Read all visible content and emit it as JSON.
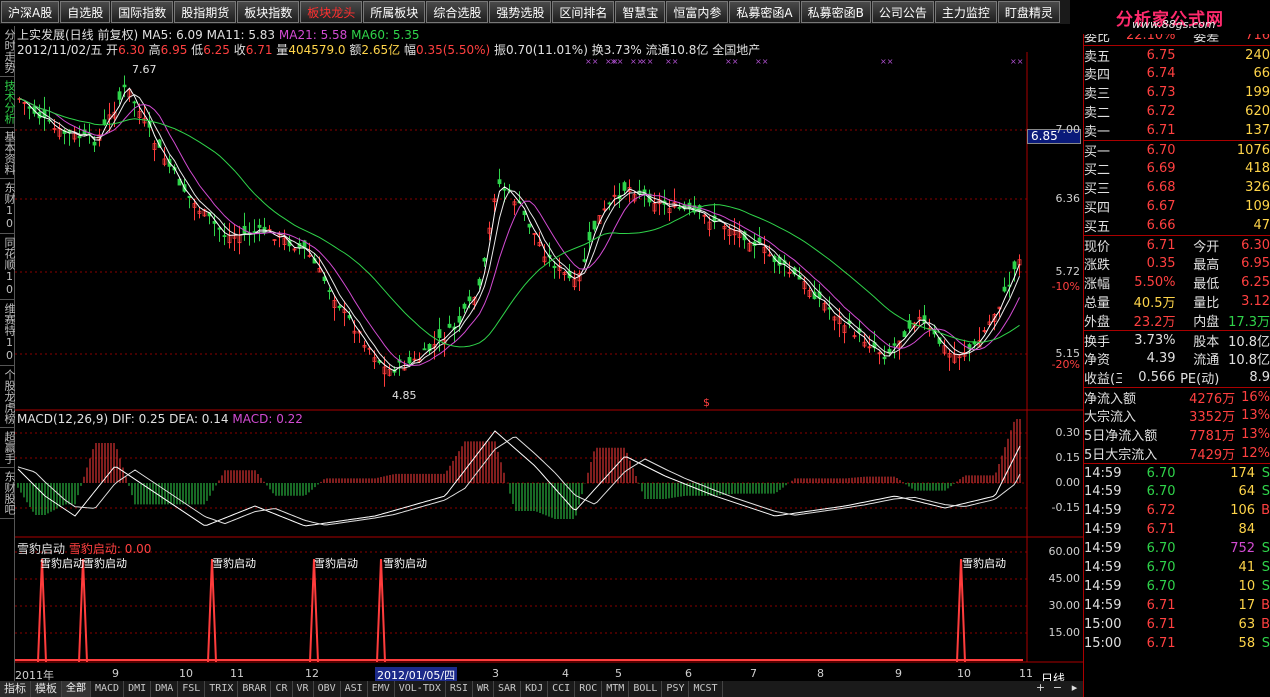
{
  "toolbar": [
    {
      "label": "沪深A股"
    },
    {
      "label": "自选股"
    },
    {
      "label": "国际指数"
    },
    {
      "label": "股指期货"
    },
    {
      "label": "板块指数"
    },
    {
      "label": "板块龙头",
      "active": true
    },
    {
      "label": "所属板块"
    },
    {
      "label": "综合选股"
    },
    {
      "label": "强势选股"
    },
    {
      "label": "区间排名"
    },
    {
      "label": "智慧宝"
    },
    {
      "label": "恒富内参"
    },
    {
      "label": "私募密函A"
    },
    {
      "label": "私募密函B"
    },
    {
      "label": "公司公告"
    },
    {
      "label": "主力监控"
    },
    {
      "label": "盯盘精灵"
    }
  ],
  "logo": {
    "title": "分析家公式网",
    "url": "www.88gs.com"
  },
  "left_nav": [
    {
      "label": "分时走势"
    },
    {
      "label": "技术分析",
      "active": true
    },
    {
      "label": "基本资料"
    },
    {
      "label": "东财10"
    },
    {
      "label": "同花顺10"
    },
    {
      "label": "维赛特10"
    },
    {
      "label": "个股龙虎榜"
    },
    {
      "label": "超赢手"
    },
    {
      "label": "东财股吧"
    }
  ],
  "header": {
    "line1": "上实发展(日线 前复权)",
    "ma5": "MA5: 6.09",
    "ma11": "MA11: 5.83",
    "ma21": "MA21: 5.58",
    "ma60": "MA60: 5.35",
    "date": "2012/11/02/五",
    "open_label": "开",
    "open": "6.30",
    "high_label": "高",
    "high": "6.95",
    "low_label": "低",
    "low": "6.25",
    "close_label": "收",
    "close": "6.71",
    "vol_label": "量",
    "vol": "404579.0",
    "amt_label": "额",
    "amt": "2.65亿",
    "chg_label": "幅",
    "chg": "0.35(5.50%)",
    "amp": "振0.70(11.01%)",
    "turn": "换3.73%",
    "float": "流通10.8亿",
    "sector": "全国地产"
  },
  "price_axis": [
    {
      "label": "7.00"
    },
    {
      "label": "6.36"
    },
    {
      "label": "5.72"
    },
    {
      "label": "-10%"
    },
    {
      "label": "5.15"
    },
    {
      "label": "-20%"
    }
  ],
  "price_tag": "6.85",
  "price_marks": {
    "high": "7.67",
    "low": "4.85",
    "s_mark": "$"
  },
  "macd": {
    "label": "MACD(12,26,9)",
    "dif": "DIF: 0.25",
    "dea": "DEA: 0.14",
    "macd": "MACD: 0.22",
    "axis": [
      {
        "label": "0.30"
      },
      {
        "label": "0.15"
      },
      {
        "label": "0.00"
      },
      {
        "label": "-0.15"
      }
    ]
  },
  "ind3": {
    "label": "雪豹启动",
    "value": "雪豹启动: 0.00",
    "signal": "雪豹启动",
    "axis": [
      {
        "label": "60.00"
      },
      {
        "label": "45.00"
      },
      {
        "label": "30.00"
      },
      {
        "label": "15.00"
      }
    ]
  },
  "x_axis": [
    {
      "label": "2011年"
    },
    {
      "label": "9"
    },
    {
      "label": "10"
    },
    {
      "label": "11"
    },
    {
      "label": "12"
    },
    {
      "label": "2012/01/05/四"
    },
    {
      "label": "3"
    },
    {
      "label": "4"
    },
    {
      "label": "5"
    },
    {
      "label": "6"
    },
    {
      "label": "7"
    },
    {
      "label": "8"
    },
    {
      "label": "9"
    },
    {
      "label": "10"
    },
    {
      "label": "11"
    }
  ],
  "period": "日线",
  "right": {
    "weibi_label": "委比",
    "weibi": "22.10%",
    "weicha_label": "委差",
    "weicha": "716",
    "asks": [
      {
        "label": "卖五",
        "price": "6.75",
        "vol": "240"
      },
      {
        "label": "卖四",
        "price": "6.74",
        "vol": "66"
      },
      {
        "label": "卖三",
        "price": "6.73",
        "vol": "199"
      },
      {
        "label": "卖二",
        "price": "6.72",
        "vol": "620"
      },
      {
        "label": "卖一",
        "price": "6.71",
        "vol": "137"
      }
    ],
    "bids": [
      {
        "label": "买一",
        "price": "6.70",
        "vol": "1076"
      },
      {
        "label": "买二",
        "price": "6.69",
        "vol": "418"
      },
      {
        "label": "买三",
        "price": "6.68",
        "vol": "326"
      },
      {
        "label": "买四",
        "price": "6.67",
        "vol": "109"
      },
      {
        "label": "买五",
        "price": "6.66",
        "vol": "47"
      }
    ],
    "stats": [
      {
        "l1": "现价",
        "v1": "6.71",
        "c1": "c-red",
        "l2": "今开",
        "v2": "6.30",
        "c2": "c-red"
      },
      {
        "l1": "涨跌",
        "v1": "0.35",
        "c1": "c-red",
        "l2": "最高",
        "v2": "6.95",
        "c2": "c-red"
      },
      {
        "l1": "涨幅",
        "v1": "5.50%",
        "c1": "c-red",
        "l2": "最低",
        "v2": "6.25",
        "c2": "c-red"
      },
      {
        "l1": "总量",
        "v1": "40.5万",
        "c1": "c-yel",
        "l2": "量比",
        "v2": "3.12",
        "c2": "c-red"
      },
      {
        "l1": "外盘",
        "v1": "23.2万",
        "c1": "c-red",
        "l2": "内盘",
        "v2": "17.3万",
        "c2": "c-grn"
      }
    ],
    "stats2": [
      {
        "l1": "换手",
        "v1": "3.73%",
        "l2": "股本",
        "v2": "10.8亿"
      },
      {
        "l1": "净资",
        "v1": "4.39",
        "l2": "流通",
        "v2": "10.8亿"
      },
      {
        "l1": "收益(三)",
        "v1": "0.566",
        "l2": "PE(动)",
        "v2": "8.9"
      }
    ],
    "flows": [
      {
        "label": "净流入额",
        "value": "4276万",
        "pct": "16%"
      },
      {
        "label": "大宗流入",
        "value": "3352万",
        "pct": "13%"
      },
      {
        "label": "5日净流入额",
        "value": "7781万",
        "pct": "13%"
      },
      {
        "label": "5日大宗流入",
        "value": "7429万",
        "pct": "12%"
      }
    ],
    "ticks": [
      {
        "t": "14:59",
        "p": "6.70",
        "v": "174",
        "s": "S",
        "pc": "c-grn",
        "vc": "c-yel",
        "sc": "c-grn"
      },
      {
        "t": "14:59",
        "p": "6.70",
        "v": "64",
        "s": "S",
        "pc": "c-grn",
        "vc": "c-yel",
        "sc": "c-grn"
      },
      {
        "t": "14:59",
        "p": "6.72",
        "v": "106",
        "s": "B",
        "pc": "c-red",
        "vc": "c-yel",
        "sc": "c-red"
      },
      {
        "t": "14:59",
        "p": "6.71",
        "v": "84",
        "s": "",
        "pc": "c-red",
        "vc": "c-yel",
        "sc": "c-grn"
      },
      {
        "t": "14:59",
        "p": "6.70",
        "v": "752",
        "s": "S",
        "pc": "c-grn",
        "vc": "c-mag",
        "sc": "c-grn"
      },
      {
        "t": "14:59",
        "p": "6.70",
        "v": "41",
        "s": "S",
        "pc": "c-grn",
        "vc": "c-yel",
        "sc": "c-grn"
      },
      {
        "t": "14:59",
        "p": "6.70",
        "v": "10",
        "s": "S",
        "pc": "c-grn",
        "vc": "c-yel",
        "sc": "c-grn"
      },
      {
        "t": "14:59",
        "p": "6.71",
        "v": "17",
        "s": "B",
        "pc": "c-red",
        "vc": "c-yel",
        "sc": "c-red"
      },
      {
        "t": "15:00",
        "p": "6.71",
        "v": "63",
        "s": "B",
        "pc": "c-red",
        "vc": "c-yel",
        "sc": "c-red"
      },
      {
        "t": "15:00",
        "p": "6.71",
        "v": "58",
        "s": "S",
        "pc": "c-red",
        "vc": "c-yel",
        "sc": "c-grn"
      }
    ]
  },
  "bottom_tabs": [
    {
      "label": "指标"
    },
    {
      "label": "模板"
    },
    {
      "label": "全部",
      "active": true
    },
    {
      "label": "MACD"
    },
    {
      "label": "DMI"
    },
    {
      "label": "DMA"
    },
    {
      "label": "FSL"
    },
    {
      "label": "TRIX"
    },
    {
      "label": "BRAR"
    },
    {
      "label": "CR"
    },
    {
      "label": "VR"
    },
    {
      "label": "OBV"
    },
    {
      "label": "ASI"
    },
    {
      "label": "EMV"
    },
    {
      "label": "VOL-TDX"
    },
    {
      "label": "RSI"
    },
    {
      "label": "WR"
    },
    {
      "label": "SAR"
    },
    {
      "label": "KDJ"
    },
    {
      "label": "CCI"
    },
    {
      "label": "ROC"
    },
    {
      "label": "MTM"
    },
    {
      "label": "BOLL"
    },
    {
      "label": "PSY"
    },
    {
      "label": "MCST"
    }
  ],
  "colors": {
    "up": "#ff3c3c",
    "down": "#2fd34a",
    "ma5": "#ffffff",
    "ma11": "#ffffff",
    "ma21": "#d24bd2",
    "ma60": "#2fd34a",
    "grid": "#a00000"
  }
}
